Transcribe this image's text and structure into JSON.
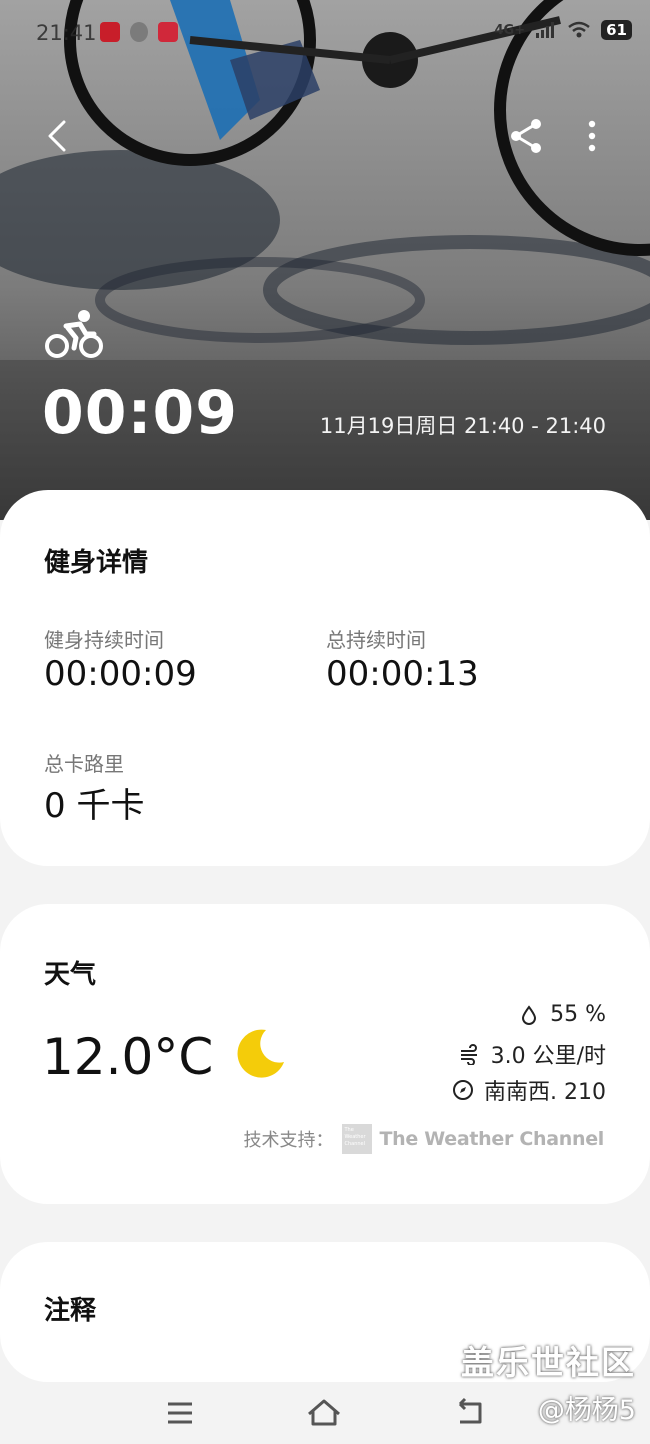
{
  "status_bar": {
    "time": "21:41",
    "network": "4G+",
    "battery": "61"
  },
  "header": {
    "back_icon": "chevron-left-icon",
    "share_icon": "share-icon",
    "more_icon": "more-vertical-icon",
    "activity_icon": "cycling-icon",
    "duration": "00:09",
    "date_range": "11月19日周日 21:40 - 21:40"
  },
  "workout_details": {
    "title": "健身详情",
    "stats": [
      {
        "label": "健身持续时间",
        "value": "00:00:09"
      },
      {
        "label": "总持续时间",
        "value": "00:00:13"
      },
      {
        "label": "总卡路里",
        "value": "0 千卡"
      }
    ]
  },
  "weather": {
    "title": "天气",
    "temperature": "12.0°C",
    "condition_icon": "crescent-moon-icon",
    "humidity": "55 %",
    "wind_speed": "3.0 公里/时",
    "wind_direction": "南南西. 210",
    "credit_label": "技术支持：",
    "provider": "The Weather Channel",
    "accent_color": "#f4cc0a"
  },
  "notes": {
    "title": "注释"
  },
  "nav": {
    "recent_icon": "menu-lines-icon",
    "home_icon": "home-icon",
    "back_icon": "back-return-icon"
  },
  "watermark": {
    "line1": "盖乐世社区",
    "line2": "@杨杨5"
  }
}
